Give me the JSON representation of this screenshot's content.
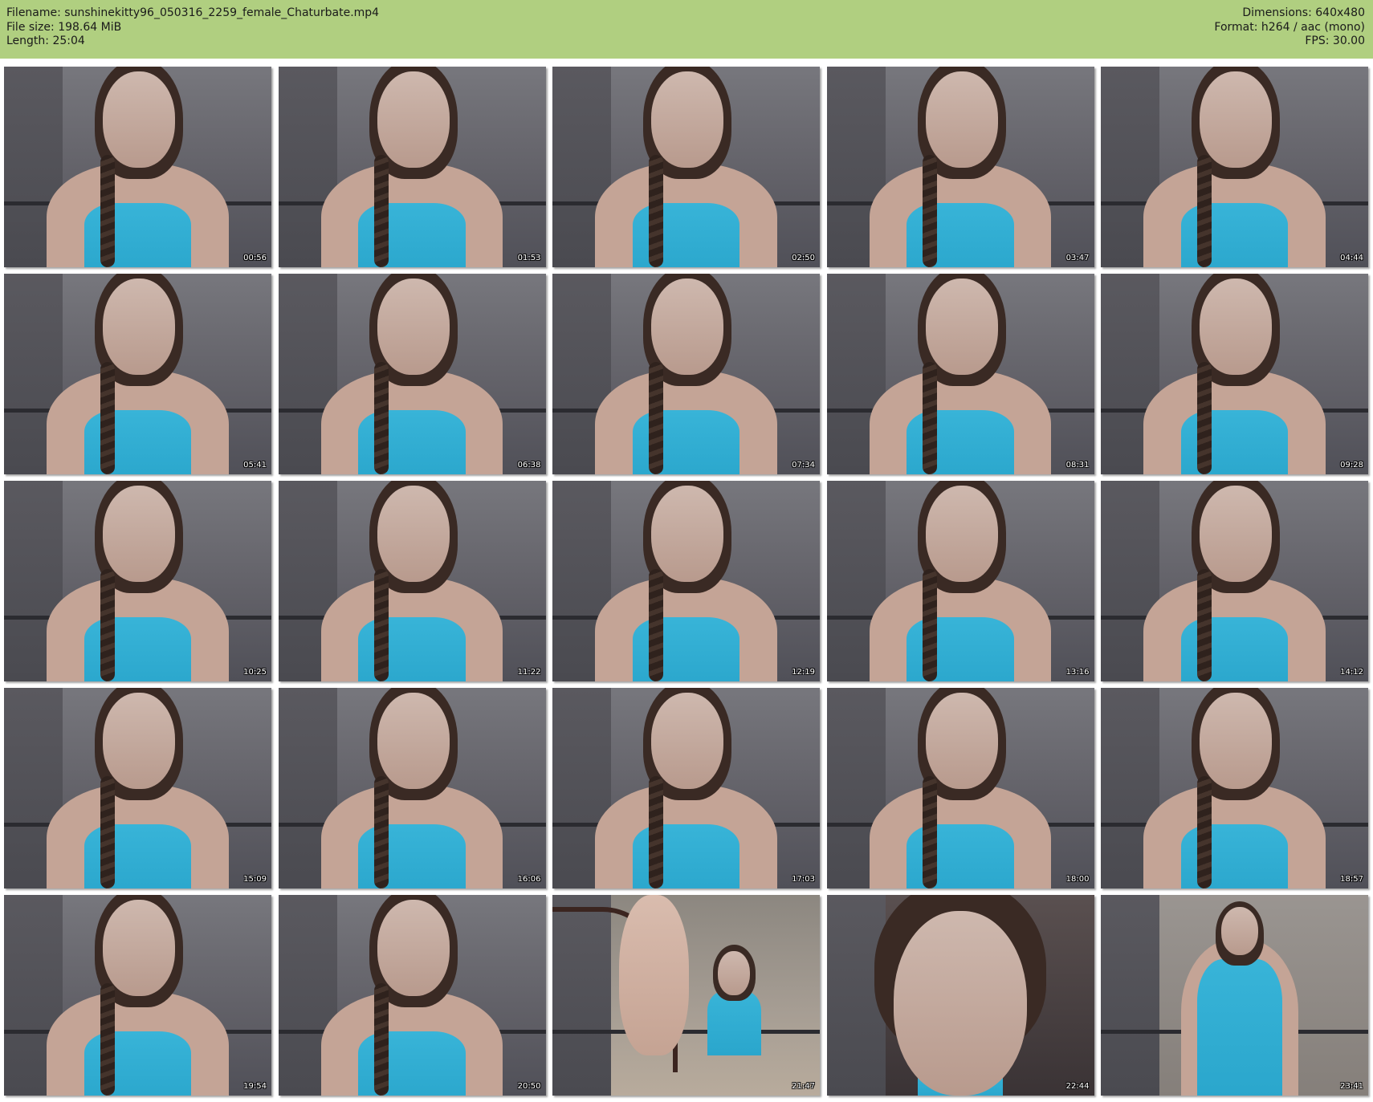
{
  "header": {
    "filename_line": "Filename: sunshinekitty96_050316_2259_female_Chaturbate.mp4",
    "filesize_line": "File size: 198.64 MiB",
    "length_line": "Length: 25:04",
    "dimensions_line": "Dimensions: 640x480",
    "format_line": "Format: h264 / aac (mono)",
    "fps_line": "FPS: 30.00",
    "background_color": "#b0cf80"
  },
  "thumbnails": [
    {
      "timestamp": "00:56",
      "scene": "webcam"
    },
    {
      "timestamp": "01:53",
      "scene": "webcam"
    },
    {
      "timestamp": "02:50",
      "scene": "webcam"
    },
    {
      "timestamp": "03:47",
      "scene": "webcam"
    },
    {
      "timestamp": "04:44",
      "scene": "webcam"
    },
    {
      "timestamp": "05:41",
      "scene": "webcam"
    },
    {
      "timestamp": "06:38",
      "scene": "webcam"
    },
    {
      "timestamp": "07:34",
      "scene": "webcam"
    },
    {
      "timestamp": "08:31",
      "scene": "webcam"
    },
    {
      "timestamp": "09:28",
      "scene": "webcam"
    },
    {
      "timestamp": "10:25",
      "scene": "webcam"
    },
    {
      "timestamp": "11:22",
      "scene": "webcam"
    },
    {
      "timestamp": "12:19",
      "scene": "webcam"
    },
    {
      "timestamp": "13:16",
      "scene": "webcam"
    },
    {
      "timestamp": "14:12",
      "scene": "webcam"
    },
    {
      "timestamp": "15:09",
      "scene": "webcam"
    },
    {
      "timestamp": "16:06",
      "scene": "webcam"
    },
    {
      "timestamp": "17:03",
      "scene": "webcam"
    },
    {
      "timestamp": "18:00",
      "scene": "webcam"
    },
    {
      "timestamp": "18:57",
      "scene": "webcam"
    },
    {
      "timestamp": "19:54",
      "scene": "webcam"
    },
    {
      "timestamp": "20:50",
      "scene": "webcam"
    },
    {
      "timestamp": "21:47",
      "scene": "floor"
    },
    {
      "timestamp": "22:44",
      "scene": "closeup"
    },
    {
      "timestamp": "23:41",
      "scene": "stand"
    }
  ]
}
